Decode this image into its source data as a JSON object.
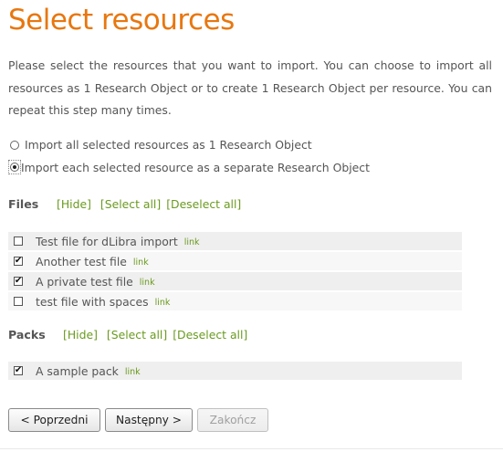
{
  "page": {
    "title": "Select resources",
    "intro": "Please select the resources that you want to import. You can choose to import all resources as 1 Research Object or to create 1 Research Object per resource. You can repeat this step many times."
  },
  "options": [
    {
      "label": "Import all selected resources as 1 Research Object",
      "selected": false
    },
    {
      "label": "Import each selected resource as a separate Research Object",
      "selected": true
    }
  ],
  "files": {
    "heading": "Files",
    "links": {
      "hide": "[Hide]",
      "select_all": "[Select all]",
      "deselect_all": "[Deselect all]"
    },
    "items": [
      {
        "name": "Test file for dLibra import",
        "link": "link",
        "checked": false
      },
      {
        "name": "Another test file",
        "link": "link",
        "checked": true
      },
      {
        "name": "A private test file",
        "link": "link",
        "checked": true
      },
      {
        "name": "test file with spaces",
        "link": "link",
        "checked": false
      }
    ]
  },
  "packs": {
    "heading": "Packs",
    "links": {
      "hide": "[Hide]",
      "select_all": "[Select all]",
      "deselect_all": "[Deselect all]"
    },
    "items": [
      {
        "name": "A sample pack",
        "link": "link",
        "checked": true
      }
    ]
  },
  "buttons": {
    "previous": "< Poprzedni",
    "next": "Następny >",
    "finish": "Zakończ"
  },
  "colors": {
    "title": "#e8770f",
    "link": "#6a9a1f",
    "text": "#555555"
  }
}
